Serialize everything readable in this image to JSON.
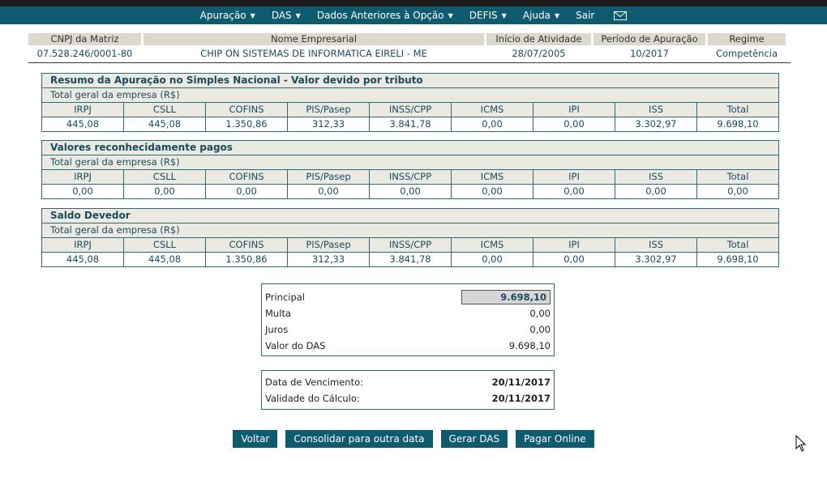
{
  "nav": [
    {
      "label": "Apuração",
      "caret": "▼"
    },
    {
      "label": "DAS",
      "caret": "▼"
    },
    {
      "label": "Dados Anteriores à Opção",
      "caret": "▼"
    },
    {
      "label": "DEFIS",
      "caret": "▼"
    },
    {
      "label": "Ajuda",
      "caret": "▼"
    },
    {
      "label": "Sair",
      "caret": ""
    }
  ],
  "company": {
    "headers": [
      "CNPJ da Matriz",
      "Nome Empresarial",
      "Início de Atividade",
      "Período de Apuração",
      "Regime"
    ],
    "values": [
      "07.528.246/0001-80",
      "CHIP ON SISTEMAS DE INFORMATICA EIRELI - ME",
      "28/07/2005",
      "10/2017",
      "Competência"
    ]
  },
  "tax_columns": [
    "IRPJ",
    "CSLL",
    "COFINS",
    "PIS/Pasep",
    "INSS/CPP",
    "ICMS",
    "IPI",
    "ISS",
    "Total"
  ],
  "sections": [
    {
      "title": "Resumo da Apuração no Simples Nacional - Valor devido por tributo",
      "subtitle": "Total geral da empresa (R$)",
      "values": [
        "445,08",
        "445,08",
        "1.350,86",
        "312,33",
        "3.841,78",
        "0,00",
        "0,00",
        "3.302,97",
        "9.698,10"
      ]
    },
    {
      "title": "Valores reconhecidamente pagos",
      "subtitle": "Total geral da empresa (R$)",
      "values": [
        "0,00",
        "0,00",
        "0,00",
        "0,00",
        "0,00",
        "0,00",
        "0,00",
        "0,00",
        "0,00"
      ]
    },
    {
      "title": "Saldo Devedor",
      "subtitle": "Total geral da empresa (R$)",
      "values": [
        "445,08",
        "445,08",
        "1.350,86",
        "312,33",
        "3.841,78",
        "0,00",
        "0,00",
        "3.302,97",
        "9.698,10"
      ]
    }
  ],
  "summary": {
    "principal_label": "Principal",
    "principal_value": "9.698,10",
    "multa_label": "Multa",
    "multa_value": "0,00",
    "juros_label": "Juros",
    "juros_value": "0,00",
    "das_label": "Valor do DAS",
    "das_value": "9.698,10"
  },
  "dates": {
    "vencimento_label": "Data de Vencimento:",
    "vencimento_value": "20/11/2017",
    "validade_label": "Validade do Cálculo:",
    "validade_value": "20/11/2017"
  },
  "buttons": {
    "voltar": "Voltar",
    "consolidar": "Consolidar para outra data",
    "gerar": "Gerar DAS",
    "pagar": "Pagar Online"
  }
}
